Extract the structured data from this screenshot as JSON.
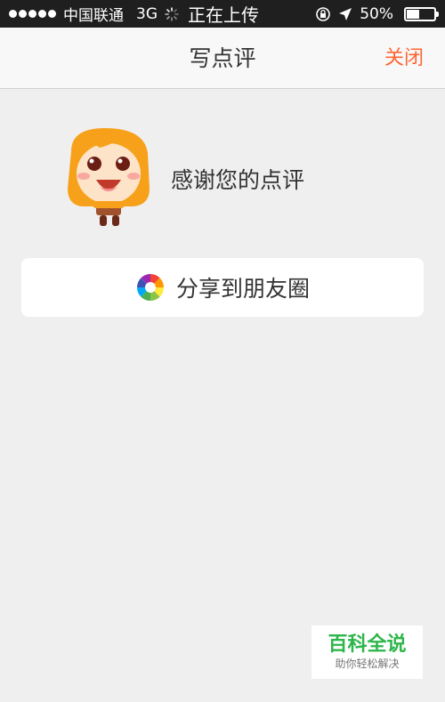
{
  "status_bar": {
    "carrier": "中国联通",
    "network": "3G",
    "activity_text": "正在上传",
    "battery_percent": "50%",
    "battery_level": 0.5,
    "icons": [
      "signal-dots-icon",
      "loading-spinner-icon",
      "rotation-lock-icon",
      "location-arrow-icon",
      "battery-icon"
    ]
  },
  "nav": {
    "title": "写点评",
    "close_label": "关闭"
  },
  "thanks": {
    "text": "感谢您的点评",
    "mascot_icon": "mascot-icon"
  },
  "share": {
    "label": "分享到朋友圈",
    "icon": "wechat-moments-icon"
  },
  "watermark": {
    "title": "百科全说",
    "subtitle": "助你轻松解决"
  },
  "colors": {
    "status_bar_bg": "#1f1f1f",
    "page_bg": "#efefef",
    "nav_bg": "#f8f8f8",
    "accent": "#ff6633",
    "mascot_orange": "#f7a11a",
    "watermark_green": "#2cb64a"
  }
}
